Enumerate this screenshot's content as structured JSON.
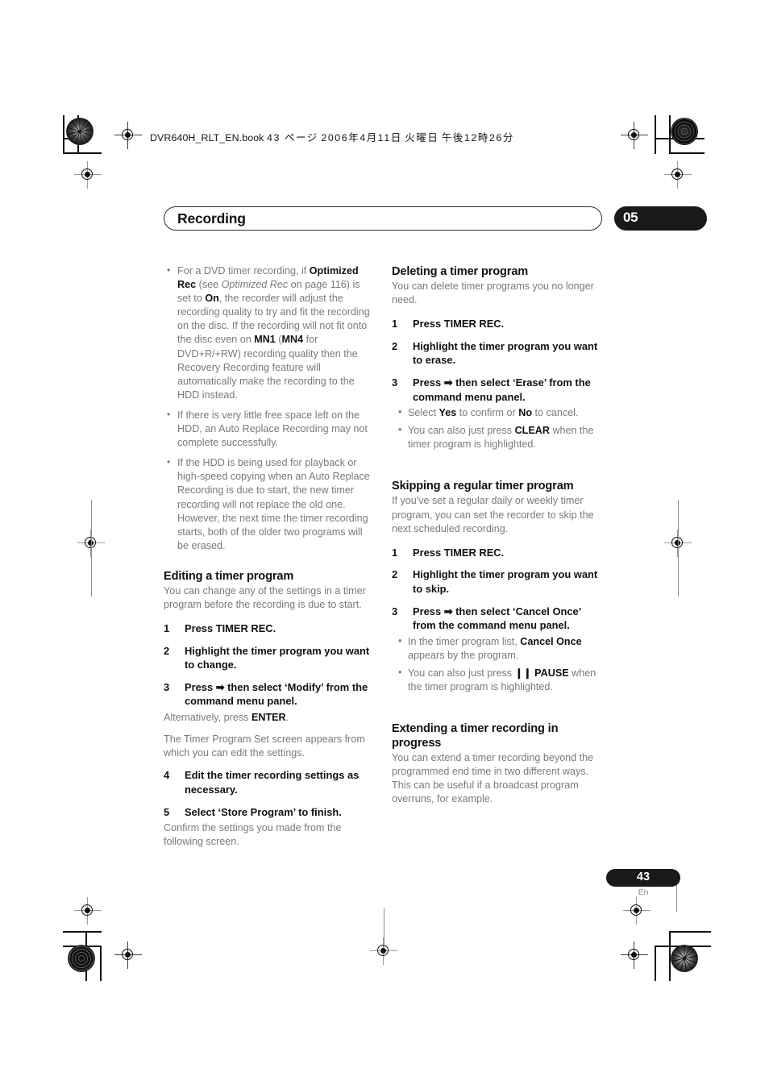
{
  "print_header": {
    "filename": "DVR640H_RLT_EN.book",
    "page_label": "43 ページ",
    "date": "2006年4月11日",
    "weekday": "火曜日",
    "time": "午後12時26分"
  },
  "running_head": {
    "title": "Recording",
    "chapter_number": "05"
  },
  "left_column": {
    "bullets": [
      {
        "segments": [
          {
            "t": "For a DVD timer recording, if ",
            "s": "normal"
          },
          {
            "t": "Optimized Rec",
            "s": "bold"
          },
          {
            "t": " (see ",
            "s": "normal"
          },
          {
            "t": "Optimized Rec",
            "s": "italic"
          },
          {
            "t": " on page 116) is set to ",
            "s": "normal"
          },
          {
            "t": "On",
            "s": "bold"
          },
          {
            "t": ", the recorder will adjust the recording quality to try and fit the recording on the disc. If the recording will not fit onto the disc even on ",
            "s": "normal"
          },
          {
            "t": "MN1",
            "s": "bold"
          },
          {
            "t": " (",
            "s": "normal"
          },
          {
            "t": "MN4",
            "s": "bold"
          },
          {
            "t": "  for DVD+R/+RW) recording quality then the Recovery Recording feature will automatically make the recording to the HDD instead.",
            "s": "normal"
          }
        ]
      },
      {
        "segments": [
          {
            "t": "If there is very little free space left on the HDD, an Auto Replace Recording may not complete successfully.",
            "s": "normal"
          }
        ]
      },
      {
        "segments": [
          {
            "t": "If the HDD is being used for playback or high-speed copying when an Auto Replace Recording is due to start, the new timer recording will not replace the old one. However, the next time the timer recording starts, both of the older two programs will be erased.",
            "s": "normal"
          }
        ]
      }
    ],
    "section": {
      "heading": "Editing a timer program",
      "lead": "You can change any of the settings in a timer program before the recording is due to start.",
      "step1_num": "1",
      "step1_text": "Press TIMER REC.",
      "step2_num": "2",
      "step2_text": "Highlight the timer program you want to change.",
      "step3_num": "3",
      "step3_text_a": "Press ",
      "step3_arrow": "➡",
      "step3_text_b": " then select ‘Modify’ from the command menu panel.",
      "step3_note_a": "Alternatively, press ",
      "step3_note_bold": "ENTER",
      "step3_note_b": ".",
      "step3_note2": "The Timer Program Set screen appears from which you can edit the settings.",
      "step4_num": "4",
      "step4_text": "Edit the timer recording settings as necessary.",
      "step5_num": "5",
      "step5_text": "Select ‘Store Program’ to finish.",
      "step5_note": "Confirm the settings you made from the following screen."
    }
  },
  "right_column": {
    "deleting": {
      "heading": "Deleting a timer program",
      "lead": "You can delete timer programs you no longer need.",
      "step1_num": "1",
      "step1_text": "Press TIMER REC.",
      "step2_num": "2",
      "step2_text": "Highlight the timer program you want to erase.",
      "step3_num": "3",
      "step3_text_a": "Press ",
      "step3_arrow": "➡",
      "step3_text_b": " then select ‘Erase’ from the command menu panel.",
      "sub1_a": "Select ",
      "sub1_bold1": "Yes",
      "sub1_b": " to confirm or ",
      "sub1_bold2": "No",
      "sub1_c": " to cancel.",
      "sub2_a": "You can also just press ",
      "sub2_bold": "CLEAR",
      "sub2_b": " when the timer program is highlighted."
    },
    "skipping": {
      "heading": "Skipping a regular timer program",
      "lead": "If you've set a regular daily or weekly timer program, you can set the recorder to skip the next scheduled recording.",
      "step1_num": "1",
      "step1_text": "Press TIMER REC.",
      "step2_num": "2",
      "step2_text": "Highlight the timer program you want to skip.",
      "step3_num": "3",
      "step3_text_a": "Press ",
      "step3_arrow": "➡",
      "step3_text_b": " then select ‘Cancel Once’ from the command menu panel.",
      "sub1_a": "In the timer program list, ",
      "sub1_bold": "Cancel Once",
      "sub1_b": " appears by the program.",
      "sub2_a": "You can also just press ",
      "sub2_pause_icon": "❙❙",
      "sub2_bold": "PAUSE",
      "sub2_b": " when the timer program is highlighted."
    },
    "extending": {
      "heading": "Extending a timer recording in progress",
      "lead": "You can extend a timer recording beyond the programmed end time in two different ways. This can be useful if a broadcast program overruns, for example."
    }
  },
  "footer": {
    "page_number": "43",
    "language": "En"
  },
  "colors": {
    "ink": "#111111",
    "body_grey": "#7a7a7a",
    "tab_black": "#191919"
  }
}
